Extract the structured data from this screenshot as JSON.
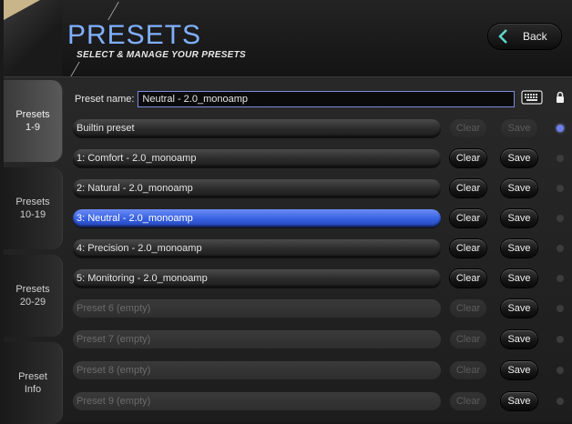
{
  "header": {
    "title": "PRESETS",
    "subtitle": "SELECT & MANAGE YOUR PRESETS",
    "back_label": "Back"
  },
  "sidebar": {
    "tabs": [
      {
        "label_line1": "Presets",
        "label_line2": "1-9",
        "active": true
      },
      {
        "label_line1": "Presets",
        "label_line2": "10-19",
        "active": false
      },
      {
        "label_line1": "Presets",
        "label_line2": "20-29",
        "active": false
      },
      {
        "label_line1": "Preset",
        "label_line2": "Info",
        "active": false
      }
    ]
  },
  "preset_name": {
    "label": "Preset name:",
    "value": "Neutral - 2.0_monoamp"
  },
  "buttons": {
    "clear": "Clear",
    "save": "Save"
  },
  "presets": [
    {
      "label": "Builtin preset",
      "state": "normal",
      "clear_enabled": false,
      "save_enabled": false,
      "dot_active": true
    },
    {
      "label": "1: Comfort - 2.0_monoamp",
      "state": "normal",
      "clear_enabled": true,
      "save_enabled": true,
      "dot_active": false
    },
    {
      "label": "2: Natural - 2.0_monoamp",
      "state": "normal",
      "clear_enabled": true,
      "save_enabled": true,
      "dot_active": false
    },
    {
      "label": "3: Neutral - 2.0_monoamp",
      "state": "selected",
      "clear_enabled": true,
      "save_enabled": true,
      "dot_active": false
    },
    {
      "label": "4: Precision - 2.0_monoamp",
      "state": "normal",
      "clear_enabled": true,
      "save_enabled": true,
      "dot_active": false
    },
    {
      "label": "5: Monitoring - 2.0_monoamp",
      "state": "normal",
      "clear_enabled": true,
      "save_enabled": true,
      "dot_active": false
    },
    {
      "label": "Preset 6 (empty)",
      "state": "empty",
      "clear_enabled": false,
      "save_enabled": true,
      "dot_active": false
    },
    {
      "label": "Preset 7 (empty)",
      "state": "empty",
      "clear_enabled": false,
      "save_enabled": true,
      "dot_active": false
    },
    {
      "label": "Preset 8 (empty)",
      "state": "empty",
      "clear_enabled": false,
      "save_enabled": true,
      "dot_active": false
    },
    {
      "label": "Preset 9 (empty)",
      "state": "empty",
      "clear_enabled": false,
      "save_enabled": true,
      "dot_active": false
    }
  ],
  "colors": {
    "accent": "#7fb0ff",
    "selected": "#3560e0",
    "back_chevron": "#5fd9c7"
  },
  "icons": {
    "keyboard": "keyboard-icon",
    "lock": "lock-icon",
    "back": "chevron-left-icon"
  }
}
